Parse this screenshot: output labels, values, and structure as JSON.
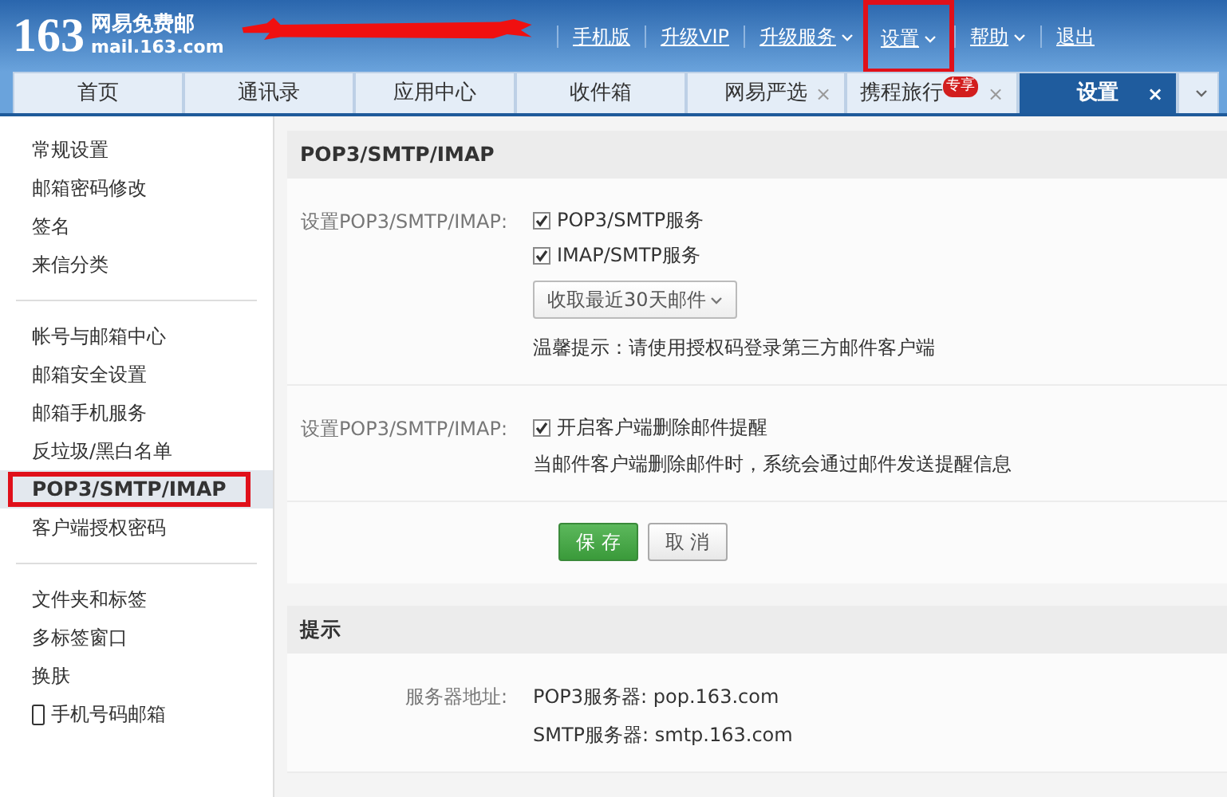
{
  "logo": {
    "number": "163",
    "name": "网易免费邮",
    "domain": "mail.163.com"
  },
  "header": {
    "redacted": true
  },
  "top_links": [
    {
      "label": "手机版",
      "dropdown": false,
      "highlighted": false
    },
    {
      "label": "升级VIP",
      "dropdown": false,
      "highlighted": false
    },
    {
      "label": "升级服务",
      "dropdown": true,
      "highlighted": false
    },
    {
      "label": "设置",
      "dropdown": true,
      "highlighted": true
    },
    {
      "label": "帮助",
      "dropdown": true,
      "highlighted": false
    },
    {
      "label": "退出",
      "dropdown": false,
      "highlighted": false
    }
  ],
  "tabs": [
    {
      "label": "首页",
      "selected": false
    },
    {
      "label": "通讯录",
      "selected": false
    },
    {
      "label": "应用中心",
      "selected": false
    },
    {
      "label": "收件箱",
      "selected": false
    },
    {
      "label": "网易严选",
      "close": "×",
      "selected": false
    },
    {
      "label": "携程旅行",
      "close": "×",
      "selected": false,
      "badge": "专享"
    },
    {
      "label": "设置",
      "close": "×",
      "selected": true
    }
  ],
  "sidebar": {
    "groups": [
      [
        {
          "label": "常规设置",
          "kind": "text",
          "selected": false,
          "highlighted": false
        },
        {
          "label": "邮箱密码修改",
          "kind": "text",
          "selected": false,
          "highlighted": false
        },
        {
          "label": "签名",
          "kind": "text",
          "selected": false,
          "highlighted": false
        },
        {
          "label": "来信分类",
          "kind": "text",
          "selected": false,
          "highlighted": false
        }
      ],
      [
        {
          "label": "帐号与邮箱中心",
          "kind": "text",
          "selected": false,
          "highlighted": false
        },
        {
          "label": "邮箱安全设置",
          "kind": "text",
          "selected": false,
          "highlighted": false
        },
        {
          "label": "邮箱手机服务",
          "kind": "text",
          "selected": false,
          "highlighted": false
        },
        {
          "label": "反垃圾/黑白名单",
          "kind": "text",
          "selected": false,
          "highlighted": false
        },
        {
          "label": "POP3/SMTP/IMAP",
          "kind": "text",
          "selected": true,
          "highlighted": true
        },
        {
          "label": "客户端授权密码",
          "kind": "text",
          "selected": false,
          "highlighted": false
        }
      ],
      [
        {
          "label": "文件夹和标签",
          "kind": "text",
          "selected": false,
          "highlighted": false
        },
        {
          "label": "多标签窗口",
          "kind": "text",
          "selected": false,
          "highlighted": false
        },
        {
          "label": "换肤",
          "kind": "text",
          "selected": false,
          "highlighted": false
        },
        {
          "label": "手机号码邮箱",
          "kind": "phone",
          "selected": false,
          "highlighted": false
        }
      ]
    ]
  },
  "sections": [
    {
      "title": "POP3/SMTP/IMAP",
      "rows": [
        {
          "label": "设置POP3/SMTP/IMAP:",
          "items": [
            {
              "kind": "checkbox",
              "label": "POP3/SMTP服务",
              "checked": true
            },
            {
              "kind": "checkbox",
              "label": "IMAP/SMTP服务",
              "checked": true
            },
            {
              "kind": "select",
              "value": "收取最近30天邮件"
            },
            {
              "kind": "note",
              "text": "温馨提示：请使用授权码登录第三方邮件客户端"
            }
          ]
        },
        {
          "label": "设置POP3/SMTP/IMAP:",
          "items": [
            {
              "kind": "checkbox",
              "label": "开启客户端删除邮件提醒",
              "checked": true
            },
            {
              "kind": "note",
              "text": "当邮件客户端删除邮件时，系统会通过邮件发送提醒信息"
            }
          ]
        }
      ],
      "buttons": [
        {
          "label": "保 存",
          "kind": "primary"
        },
        {
          "label": "取 消",
          "kind": "secondary"
        }
      ]
    },
    {
      "title": "提示",
      "rows": [
        {
          "label": "服务器地址:",
          "items": [
            {
              "kind": "note",
              "text": "POP3服务器: pop.163.com"
            },
            {
              "kind": "note",
              "text": "SMTP服务器: smtp.163.com"
            }
          ]
        }
      ]
    }
  ]
}
